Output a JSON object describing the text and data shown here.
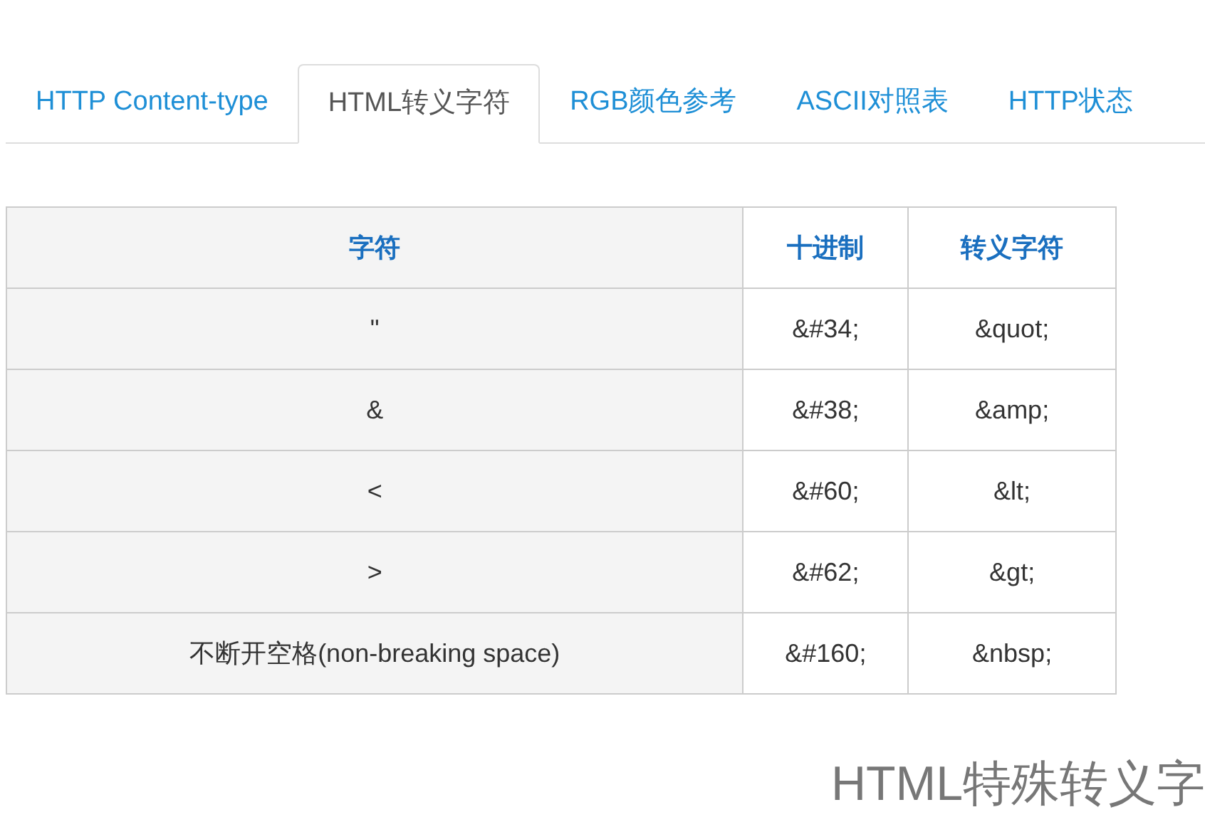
{
  "tabs": [
    {
      "label": "HTTP Content-type",
      "selected": false
    },
    {
      "label": "HTML转义字符",
      "selected": true
    },
    {
      "label": "RGB颜色参考",
      "selected": false
    },
    {
      "label": "ASCII对照表",
      "selected": false
    },
    {
      "label": "HTTP状态",
      "selected": false
    }
  ],
  "table": {
    "columns": [
      "字符",
      "十进制",
      "转义字符"
    ],
    "rows": [
      [
        "\"",
        "&#34;",
        "&quot;"
      ],
      [
        "&",
        "&#38;",
        "&amp;"
      ],
      [
        "<",
        "&#60;",
        "&lt;"
      ],
      [
        ">",
        "&#62;",
        "&gt;"
      ],
      [
        "不断开空格(non-breaking space)",
        "&#160;",
        "&nbsp;"
      ]
    ]
  },
  "heading": "HTML特殊转义字"
}
